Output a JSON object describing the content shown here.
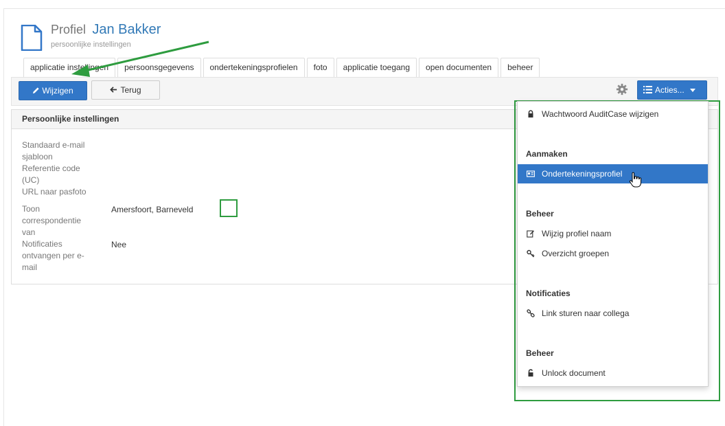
{
  "header": {
    "title_prefix": "Profiel",
    "title_name": "Jan Bakker",
    "subtitle": "persoonlijke instellingen"
  },
  "tabs": [
    {
      "label": "applicatie instellingen"
    },
    {
      "label": "persoonsgegevens"
    },
    {
      "label": "ondertekeningsprofielen"
    },
    {
      "label": "foto"
    },
    {
      "label": "applicatie toegang"
    },
    {
      "label": "open documenten"
    },
    {
      "label": "beheer"
    }
  ],
  "toolbar": {
    "edit_label": "Wijzigen",
    "back_label": "Terug",
    "actions_label": "Acties..."
  },
  "panel": {
    "title": "Persoonlijke instellingen",
    "fields": [
      {
        "label": "Standaard e-mail sjabloon",
        "value": ""
      },
      {
        "label": "Referentie code (UC)",
        "value": ""
      },
      {
        "label": "URL naar pasfoto",
        "value": ""
      },
      {
        "label": "Toon correspondentie van",
        "value": "Amersfoort, Barneveld"
      },
      {
        "label": "Notificaties ontvangen per e-mail",
        "value": "Nee"
      }
    ]
  },
  "menu": {
    "change_password": "Wachtwoord AuditCase wijzigen",
    "header_aanmaken": "Aanmaken",
    "ondertekeningsprofiel": "Ondertekeningsprofiel",
    "header_beheer": "Beheer",
    "wijzig_profiel_naam": "Wijzig profiel naam",
    "overzicht_groepen": "Overzicht groepen",
    "header_notificaties": "Notificaties",
    "link_sturen": "Link sturen naar collega",
    "header_beheer2": "Beheer",
    "unlock_document": "Unlock document"
  },
  "icons": {
    "doc": "document-icon",
    "pencil": "pencil-icon",
    "back": "arrow-left-icon",
    "gear": "gear-icon",
    "list": "list-icon",
    "lock": "lock-icon",
    "card": "id-card-icon",
    "edit": "edit-icon",
    "key": "key-icon",
    "link": "link-icon",
    "unlock": "unlock-icon"
  },
  "colors": {
    "primary": "#3277c8",
    "annotation_green": "#2e9c3f",
    "title_blue": "#337ab7"
  }
}
